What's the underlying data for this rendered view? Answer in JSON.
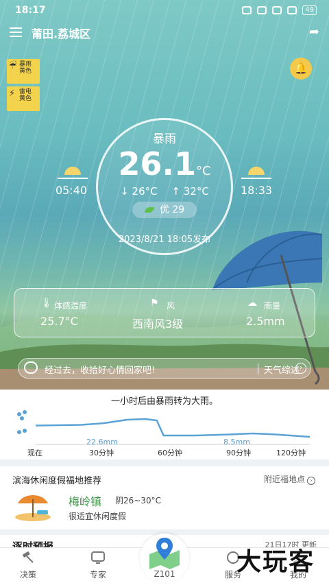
{
  "status_bar": {
    "time": "18:17",
    "icons": [
      "alarm-icon",
      "mute-icon",
      "wifi-icon",
      "signal-icon"
    ],
    "battery": "49"
  },
  "header": {
    "location": "莆田.荔城区",
    "icons": [
      "menu-icon",
      "share-icon"
    ]
  },
  "alerts": [
    {
      "type": "rainstorm",
      "label": "暴雨",
      "level_text": "黄色",
      "color": "#f3d34b"
    },
    {
      "type": "thunder",
      "label": "雷电",
      "level_text": "黄色",
      "color": "#f3d34b"
    }
  ],
  "current": {
    "condition": "暴雨",
    "temp": "26.1",
    "unit": "°C",
    "low": "↓ 26°C",
    "high": "↑ 32°C",
    "aqi_label": "优 29",
    "publish_time": "2023/8/21 18:05发布",
    "sunrise": "05:40",
    "sunset": "18:33"
  },
  "details": [
    {
      "label": "体感温度",
      "value": "25.7°C",
      "icon": "thermometer-icon"
    },
    {
      "label": "风",
      "value": "西南风3级",
      "icon": "windsock-icon"
    },
    {
      "label": "雨量",
      "value": "2.5mm",
      "icon": "rain-cloud-icon"
    }
  ],
  "tip": {
    "text": "经过去，收拾好心情回家吧!",
    "summary_label": "天气综述"
  },
  "precip": {
    "headline": "一小时后由暴雨转为大雨。",
    "x_labels": [
      "现在",
      "30分钟",
      "60分钟",
      "90分钟",
      "120分钟"
    ],
    "annotations": [
      {
        "text": "22.6mm",
        "minute": 30
      },
      {
        "text": "8.5mm",
        "minute": 90
      }
    ],
    "series": [
      {
        "minute": 0,
        "level": 0.55
      },
      {
        "minute": 10,
        "level": 0.56
      },
      {
        "minute": 20,
        "level": 0.57
      },
      {
        "minute": 30,
        "level": 0.62
      },
      {
        "minute": 40,
        "level": 0.72
      },
      {
        "minute": 48,
        "level": 0.74
      },
      {
        "minute": 53,
        "level": 0.7
      },
      {
        "minute": 56,
        "level": 0.26
      },
      {
        "minute": 70,
        "level": 0.26
      },
      {
        "minute": 85,
        "level": 0.29
      },
      {
        "minute": 95,
        "level": 0.32
      },
      {
        "minute": 105,
        "level": 0.29
      },
      {
        "minute": 120,
        "level": 0.22
      }
    ],
    "line_color": "#5aa2d6"
  },
  "recommend": {
    "title": "滨海休闲度假福地推荐",
    "more_label": "附近福地点",
    "place": "梅岭镇",
    "weather": "阴26~30°C",
    "desc": "很适宜休闲度假"
  },
  "hourly": {
    "title": "逐时预报",
    "update": "21日17时 更新"
  },
  "bottom_nav": [
    {
      "label": "决策",
      "icon": "gavel-icon"
    },
    {
      "label": "专家",
      "icon": "expert-screen-icon"
    },
    {
      "label": "Z101",
      "icon": "map-pin-icon"
    },
    {
      "label": "服务",
      "icon": "service-icon"
    },
    {
      "label": "我的",
      "icon": "user-icon"
    }
  ],
  "watermark": "大玩客",
  "colors": {
    "accent_green": "#3ca046",
    "alert_yellow": "#f3d34b",
    "chart_blue": "#5aa2d6"
  }
}
